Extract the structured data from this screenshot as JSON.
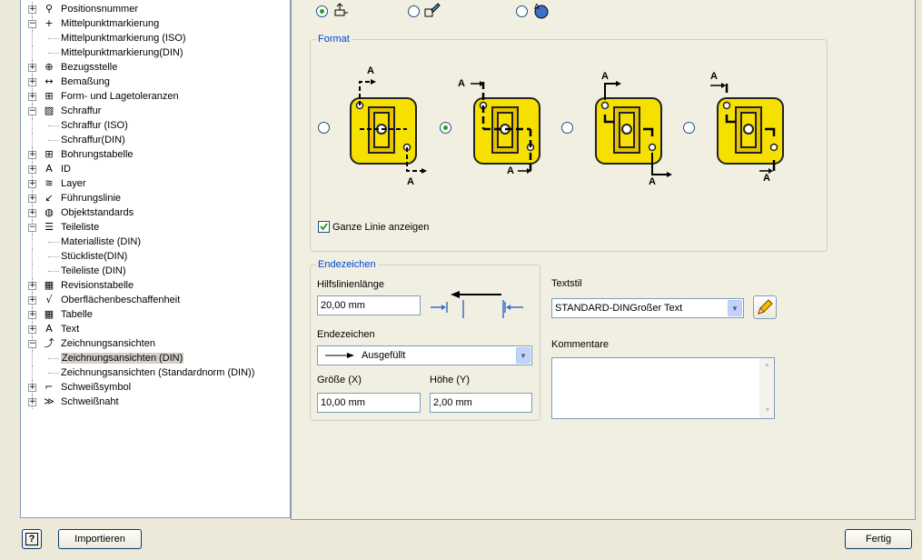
{
  "tree": [
    {
      "label": "Positionsnummer",
      "level": 0,
      "exp": "+",
      "icon": "balloon-icon",
      "glyph": "⚲"
    },
    {
      "label": "Mittelpunktmarkierung",
      "level": 0,
      "exp": "−",
      "icon": "centermark-icon",
      "glyph": "+"
    },
    {
      "label": "Mittelpunktmarkierung (ISO)",
      "level": 1
    },
    {
      "label": "Mittelpunktmarkierung(DIN)",
      "level": 1
    },
    {
      "label": "Bezugsstelle",
      "level": 0,
      "exp": "+",
      "icon": "datum-icon",
      "glyph": "⊕"
    },
    {
      "label": "Bemaßung",
      "level": 0,
      "exp": "+",
      "icon": "dimension-icon",
      "glyph": "↔"
    },
    {
      "label": "Form- und Lagetoleranzen",
      "level": 0,
      "exp": "+",
      "icon": "tolerance-icon",
      "glyph": "⊞"
    },
    {
      "label": "Schraffur",
      "level": 0,
      "exp": "−",
      "icon": "hatch-icon",
      "glyph": "▨"
    },
    {
      "label": "Schraffur (ISO)",
      "level": 1
    },
    {
      "label": "Schraffur(DIN)",
      "level": 1
    },
    {
      "label": "Bohrungstabelle",
      "level": 0,
      "exp": "+",
      "icon": "holetable-icon",
      "glyph": "⊞"
    },
    {
      "label": "ID",
      "level": 0,
      "exp": "+",
      "icon": "id-icon",
      "glyph": "A"
    },
    {
      "label": "Layer",
      "level": 0,
      "exp": "+",
      "icon": "layer-icon",
      "glyph": "≋"
    },
    {
      "label": "Führungslinie",
      "level": 0,
      "exp": "+",
      "icon": "leader-icon",
      "glyph": "↙"
    },
    {
      "label": "Objektstandards",
      "level": 0,
      "exp": "+",
      "icon": "globe-icon",
      "glyph": "◍"
    },
    {
      "label": "Teileliste",
      "level": 0,
      "exp": "−",
      "icon": "partslist-icon",
      "glyph": "☰"
    },
    {
      "label": "Materialliste (DIN)",
      "level": 1
    },
    {
      "label": "Stückliste(DIN)",
      "level": 1
    },
    {
      "label": "Teileliste (DIN)",
      "level": 1
    },
    {
      "label": "Revisionstabelle",
      "level": 0,
      "exp": "+",
      "icon": "revtable-icon",
      "glyph": "▦"
    },
    {
      "label": "Oberflächenbeschaffenheit",
      "level": 0,
      "exp": "+",
      "icon": "surface-icon",
      "glyph": "√"
    },
    {
      "label": "Tabelle",
      "level": 0,
      "exp": "+",
      "icon": "table-icon",
      "glyph": "▦"
    },
    {
      "label": "Text",
      "level": 0,
      "exp": "+",
      "icon": "text-icon",
      "glyph": "A"
    },
    {
      "label": "Zeichnungsansichten",
      "level": 0,
      "exp": "−",
      "icon": "views-icon",
      "glyph": "⤴"
    },
    {
      "label": "Zeichnungsansichten (DIN)",
      "level": 1,
      "selected": true
    },
    {
      "label": "Zeichnungsansichten (Standardnorm (DIN))",
      "level": 1
    },
    {
      "label": "Schweißsymbol",
      "level": 0,
      "exp": "+",
      "icon": "weldsymbol-icon",
      "glyph": "⌐"
    },
    {
      "label": "Schweißnaht",
      "level": 0,
      "exp": "+",
      "icon": "weldbead-icon",
      "glyph": "≫"
    }
  ],
  "format": {
    "title": "Format",
    "show_full_line": "Ganze Linie anzeigen",
    "letter": "A"
  },
  "endzeichen": {
    "title": "Endezeichen",
    "extension_label": "Hilfslinienlänge",
    "extension_value": "20,00 mm",
    "arrow_label": "Endezeichen",
    "arrow_value": "Ausgefüllt",
    "size_label": "Größe (X)",
    "size_value": "10,00 mm",
    "height_label": "Höhe (Y)",
    "height_value": "2,00 mm"
  },
  "textstyle": {
    "label": "Textstil",
    "value": "STANDARD-DINGroßer Text"
  },
  "comments": {
    "label": "Kommentare"
  },
  "footer": {
    "import": "Importieren",
    "done": "Fertig",
    "help": "?"
  },
  "colors": {
    "accent": "#0046d5",
    "part_yellow": "#f6e000"
  }
}
